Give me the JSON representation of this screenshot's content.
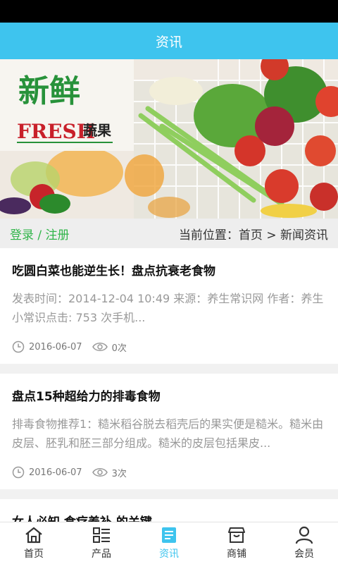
{
  "header": {
    "title": "资讯"
  },
  "banner": {
    "title_cn": "新鲜",
    "title_en": "FRESH",
    "title_sub": "蔬果"
  },
  "toolbar": {
    "login": "登录",
    "separator": "/",
    "register": "注册",
    "breadcrumb": "当前位置：首页 > 新闻资讯"
  },
  "articles": [
    {
      "title": "吃圆白菜也能逆生长！盘点抗衰老食物",
      "desc": "发表时间：2014-12-04 10:49 来源：养生常识网 作者：养生小常识点击: 753 次手机...",
      "date": "2016-06-07",
      "views": "0次"
    },
    {
      "title": "盘点15种超给力的排毒食物",
      "desc": "排毒食物推荐1：糙米稻谷脱去稻壳后的果实便是糙米。糙米由皮层、胚乳和胚三部分组成。糙米的皮层包括果皮...",
      "date": "2016-06-07",
      "views": "3次"
    },
    {
      "title": "女人必知 食疗养补 的关键"
    }
  ],
  "tabs": [
    {
      "label": "首页",
      "icon": "home-icon"
    },
    {
      "label": "产品",
      "icon": "list-icon"
    },
    {
      "label": "资讯",
      "icon": "news-icon"
    },
    {
      "label": "商铺",
      "icon": "shop-icon"
    },
    {
      "label": "会员",
      "icon": "user-icon"
    }
  ],
  "colors": {
    "accent": "#3ec4ee",
    "green": "#31b54a",
    "red": "#c8202a"
  }
}
